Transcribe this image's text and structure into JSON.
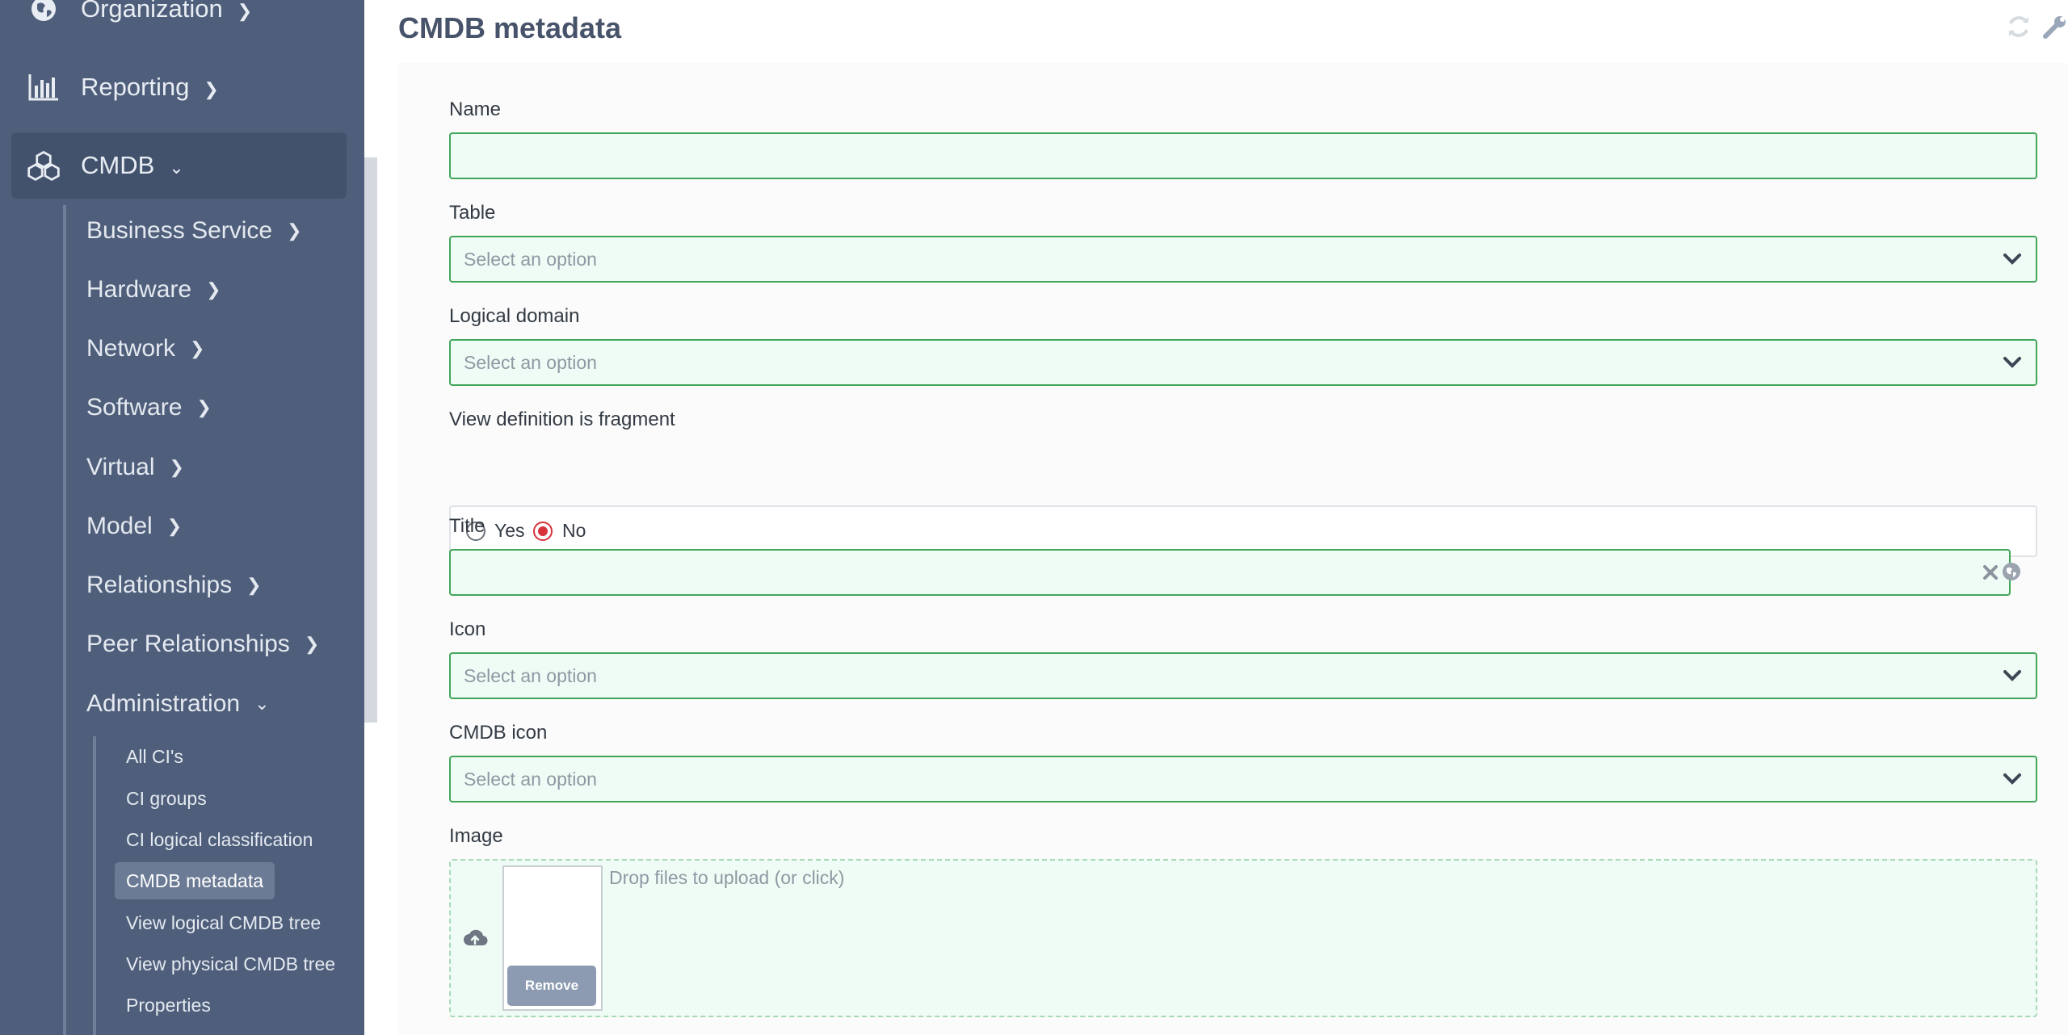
{
  "sidebar": {
    "top_items": [
      {
        "label": "Organization",
        "icon": "globe-icon"
      },
      {
        "label": "Reporting",
        "icon": "bar-chart-icon"
      },
      {
        "label": "CMDB",
        "icon": "cubes-icon"
      }
    ],
    "cmdb_items": [
      {
        "label": "Business Service"
      },
      {
        "label": "Hardware"
      },
      {
        "label": "Network"
      },
      {
        "label": "Software"
      },
      {
        "label": "Virtual"
      },
      {
        "label": "Model"
      },
      {
        "label": "Relationships"
      },
      {
        "label": "Peer Relationships"
      },
      {
        "label": "Administration"
      }
    ],
    "admin_items": [
      {
        "label": "All CI's"
      },
      {
        "label": "CI groups"
      },
      {
        "label": "CI logical classification"
      },
      {
        "label": "CMDB metadata"
      },
      {
        "label": "View logical CMDB tree"
      },
      {
        "label": "View physical CMDB tree"
      },
      {
        "label": "Properties"
      }
    ]
  },
  "main": {
    "title": "CMDB metadata",
    "form": {
      "name": {
        "label": "Name",
        "value": ""
      },
      "table": {
        "label": "Table",
        "placeholder": "Select an option"
      },
      "logical_domain": {
        "label": "Logical domain",
        "placeholder": "Select an option"
      },
      "view_fragment": {
        "label": "View definition is fragment",
        "yes": "Yes",
        "no": "No",
        "selected": "No"
      },
      "title": {
        "label": "Title",
        "value": ""
      },
      "icon": {
        "label": "Icon",
        "placeholder": "Select an option"
      },
      "cmdb_icon": {
        "label": "CMDB icon",
        "placeholder": "Select an option"
      },
      "image": {
        "label": "Image",
        "drop_text": "Drop files to upload (or click)",
        "remove_label": "Remove"
      }
    }
  },
  "colors": {
    "sidebar_bg": "#4f5f7b",
    "field_border": "#41a55a",
    "field_bg": "#effcf5",
    "radio_selected": "#d9323c"
  }
}
